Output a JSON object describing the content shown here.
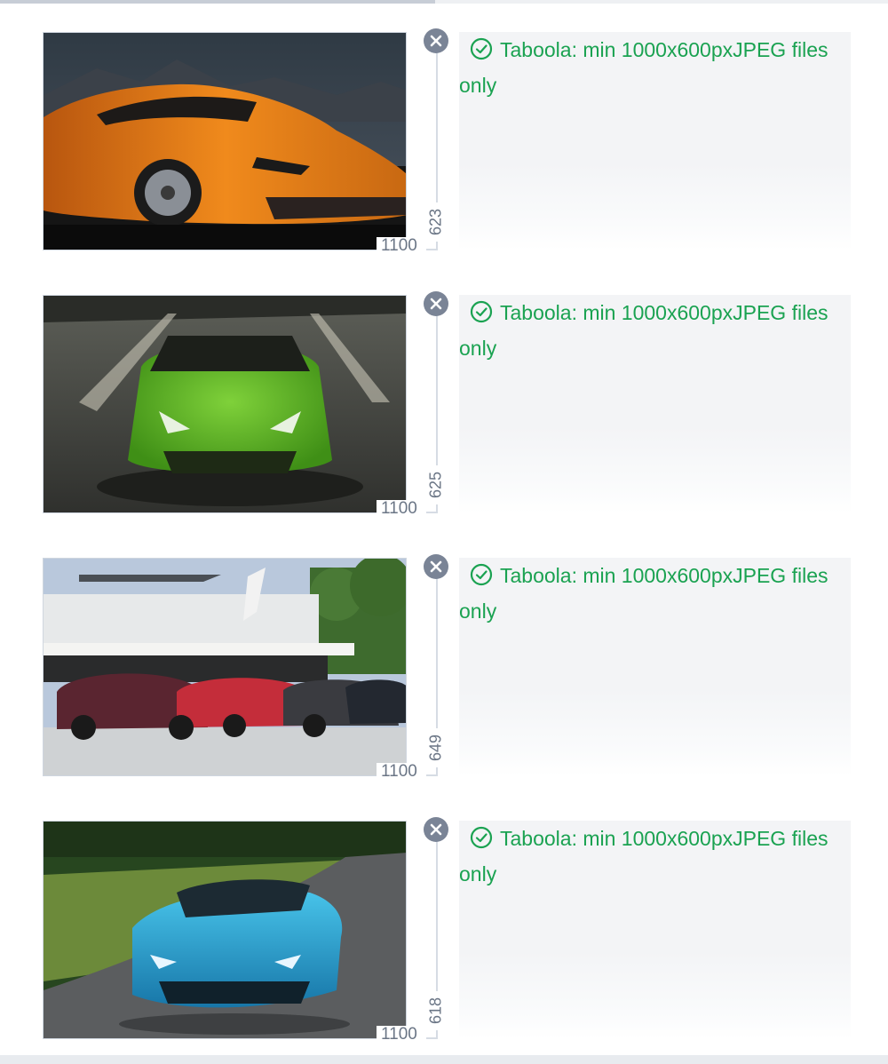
{
  "theme": {
    "success_color": "#1aa251",
    "remove_button_color": "#7a8496",
    "panel_color": "#f3f4f6"
  },
  "upload_progress": 0.49,
  "images": [
    {
      "subject": "orange sports car on mountain road",
      "width_label": "1100",
      "height_label": "623",
      "status_text": "Taboola: min 1000x600pxJPEG files only",
      "status_icon": "check-circle-icon",
      "remove_icon": "close-icon"
    },
    {
      "subject": "green convertible sports car",
      "width_label": "1100",
      "height_label": "625",
      "status_text": "Taboola: min 1000x600pxJPEG files only",
      "status_icon": "check-circle-icon",
      "remove_icon": "close-icon"
    },
    {
      "subject": "row of hypercars beside modern building with helicopter",
      "width_label": "1100",
      "height_label": "649",
      "status_text": "Taboola: min 1000x600pxJPEG files only",
      "status_icon": "check-circle-icon",
      "remove_icon": "close-icon"
    },
    {
      "subject": "blue roadster sports car on forest road",
      "width_label": "1100",
      "height_label": "618",
      "status_text": "Taboola: min 1000x600pxJPEG files only",
      "status_icon": "check-circle-icon",
      "remove_icon": "close-icon"
    }
  ]
}
